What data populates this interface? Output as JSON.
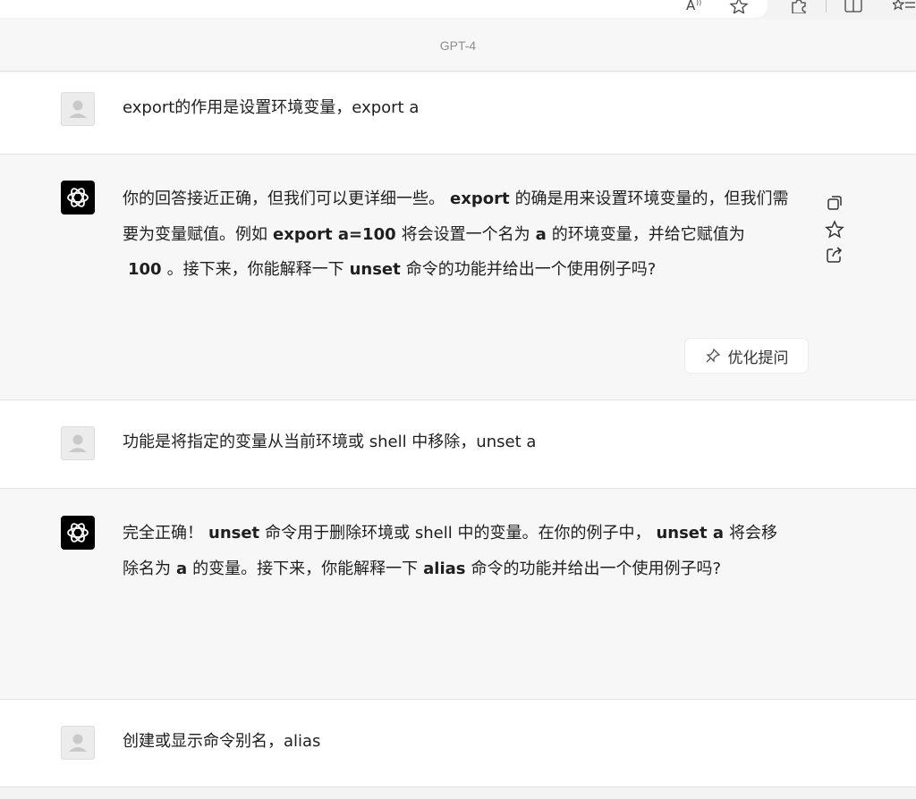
{
  "browser": {
    "url_fragment": "3134209",
    "icons": [
      "read-aloud-icon",
      "favorite-star-icon",
      "extensions-icon",
      "split-screen-icon",
      "favorites-list-icon"
    ]
  },
  "header": {
    "model": "GPT-4"
  },
  "conversation": [
    {
      "role": "user",
      "text": "export的作用是设置环境变量，export a"
    },
    {
      "role": "assistant",
      "parts": [
        "你的回答接近正确，但我们可以更详细一些。",
        "export",
        "的确是用来设置环境变量的，但我们需要为变量赋值。例如",
        "export a=100",
        "将会设置一个名为",
        "a",
        "的环境变量，并给它赋值为",
        "100",
        "。接下来，你能解释一下",
        "unset",
        "命令的功能并给出一个使用例子吗?"
      ],
      "optimize_label": "优化提问"
    },
    {
      "role": "user",
      "text": "功能是将指定的变量从当前环境或 shell 中移除，unset a"
    },
    {
      "role": "assistant",
      "parts": [
        "完全正确！",
        "unset",
        "命令用于删除环境或 shell 中的变量。在你的例子中，",
        "unset a",
        "将会移除名为",
        "a",
        "的变量。接下来，你能解释一下",
        "alias",
        "命令的功能并给出一个使用例子吗?"
      ]
    },
    {
      "role": "user",
      "text": "创建或显示命令别名，alias"
    }
  ],
  "actions": {
    "icons": [
      "copy-icon",
      "star-icon",
      "share-icon"
    ]
  },
  "colors": {
    "user_bg": "#ffffff",
    "assistant_bg": "#f7f7f8",
    "bot_avatar": "#000000"
  }
}
